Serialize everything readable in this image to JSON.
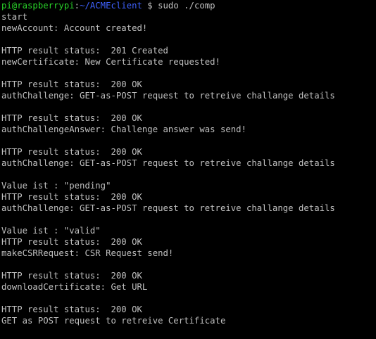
{
  "colors": {
    "background": "#000000",
    "text": "#c0c0c0",
    "prompt_user": "#29d329",
    "prompt_path": "#3f62ff"
  },
  "prompt": {
    "user_host": "pi@raspberrypi",
    "separator": ":",
    "path": "~/ACMEclient",
    "symbol": " $ ",
    "command": "sudo ./comp"
  },
  "lines": [
    "start",
    "newAccount: Account created!",
    "",
    "HTTP result status:  201 Created",
    "newCertificate: New Certificate requested!",
    "",
    "HTTP result status:  200 OK",
    "authChallenge: GET-as-POST request to retreive challange details",
    "",
    "HTTP result status:  200 OK",
    "authChallengeAnswer: Challenge answer was send!",
    "",
    "HTTP result status:  200 OK",
    "authChallenge: GET-as-POST request to retreive challange details",
    "",
    "Value ist : \"pending\"",
    "HTTP result status:  200 OK",
    "authChallenge: GET-as-POST request to retreive challange details",
    "",
    "Value ist : \"valid\"",
    "HTTP result status:  200 OK",
    "makeCSRRequest: CSR Request send!",
    "",
    "HTTP result status:  200 OK",
    "downloadCertificate: Get URL",
    "",
    "HTTP result status:  200 OK",
    "GET as POST request to retreive Certificate"
  ]
}
